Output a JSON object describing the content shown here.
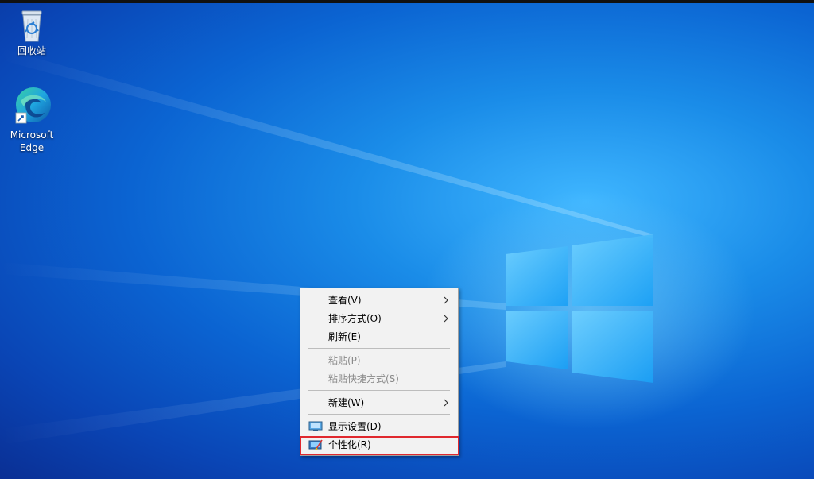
{
  "desktop": {
    "icons": [
      {
        "id": "recycle-bin",
        "label": "回收站",
        "icon": "recycle-bin-icon"
      },
      {
        "id": "edge",
        "label": "Microsoft\nEdge",
        "icon": "edge-icon",
        "shortcut": true
      }
    ]
  },
  "context_menu": {
    "items": [
      {
        "label": "查看(V)",
        "submenu": true,
        "enabled": true
      },
      {
        "label": "排序方式(O)",
        "submenu": true,
        "enabled": true
      },
      {
        "label": "刷新(E)",
        "enabled": true
      },
      {
        "label": "粘贴(P)",
        "enabled": false
      },
      {
        "label": "粘贴快捷方式(S)",
        "enabled": false
      },
      {
        "label": "新建(W)",
        "submenu": true,
        "enabled": true
      },
      {
        "label": "显示设置(D)",
        "icon": "display-settings-icon",
        "enabled": true
      },
      {
        "label": "个性化(R)",
        "icon": "personalize-icon",
        "enabled": true,
        "highlighted": true
      }
    ]
  },
  "colors": {
    "accent": "#0b64d2",
    "highlight_border": "#e0282e",
    "menu_bg": "#f2f2f2"
  }
}
